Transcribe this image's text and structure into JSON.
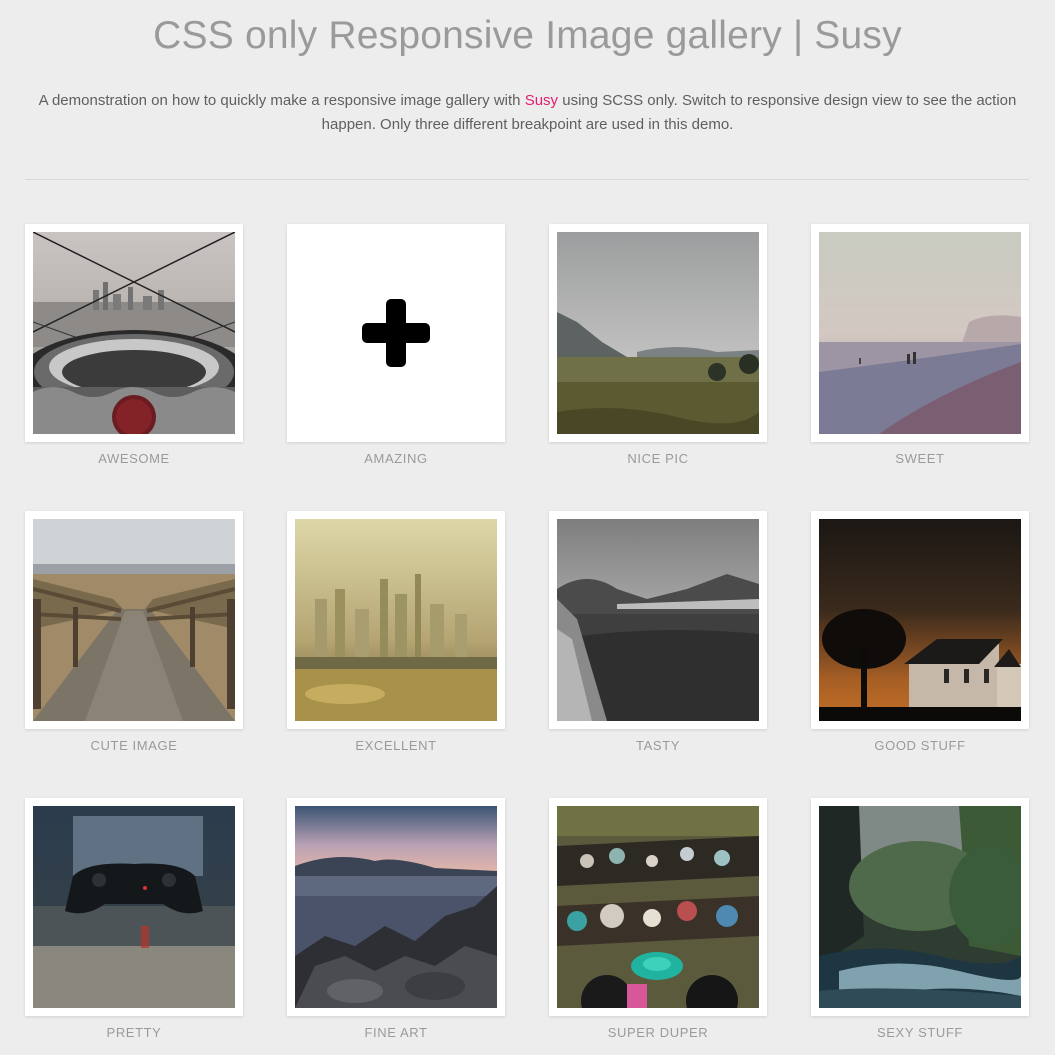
{
  "header": {
    "title": "CSS only Responsive Image gallery | Susy",
    "intro_before": "A demonstration on how to quickly make a responsive image gallery with ",
    "intro_link": "Susy",
    "intro_after": " using SCSS only. Switch to responsive design view to see the action happen. Only three different breakpoint are used in this demo."
  },
  "colors": {
    "background": "#ededed",
    "link": "#e0206f",
    "caption": "#9a9a9a",
    "title": "#9a9a9a"
  },
  "gallery": {
    "items": [
      {
        "caption": "AWESOME",
        "icon": "city-view-photo"
      },
      {
        "caption": "AMAZING",
        "icon": "plus-icon"
      },
      {
        "caption": "NICE PIC",
        "icon": "valley-photo"
      },
      {
        "caption": "SWEET",
        "icon": "beach-photo"
      },
      {
        "caption": "CUTE IMAGE",
        "icon": "boardwalk-photo"
      },
      {
        "caption": "EXCELLENT",
        "icon": "hazy-city-photo"
      },
      {
        "caption": "TASTY",
        "icon": "mountain-grass-photo"
      },
      {
        "caption": "GOOD STUFF",
        "icon": "church-night-photo"
      },
      {
        "caption": "PRETTY",
        "icon": "game-controller-photo"
      },
      {
        "caption": "FINE ART",
        "icon": "rocky-shore-photo"
      },
      {
        "caption": "SUPER DUPER",
        "icon": "floating-market-photo"
      },
      {
        "caption": "SEXY STUFF",
        "icon": "forest-stream-photo"
      }
    ]
  }
}
